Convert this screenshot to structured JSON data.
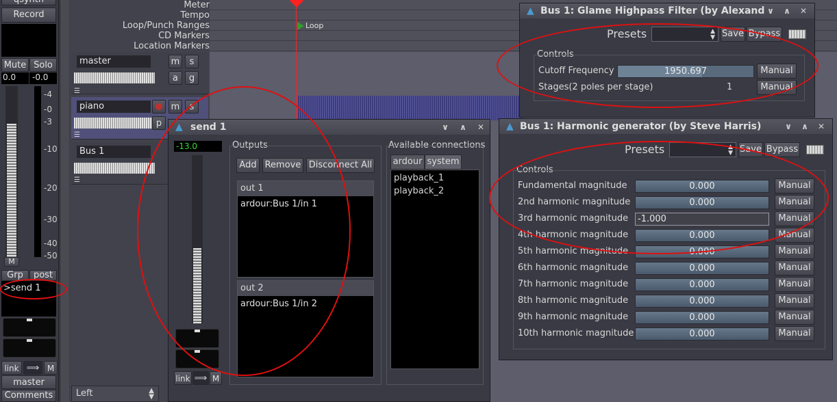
{
  "mixer": {
    "top_label": "qsynth",
    "record": "Record",
    "mute": "Mute",
    "solo": "Solo",
    "gain": "0.0",
    "peak": "-0.0",
    "scale": [
      "-4",
      "-0",
      "-3",
      "-10",
      "-20",
      "-30",
      "-40",
      "-50"
    ],
    "meter_m": "M",
    "grp": "Grp",
    "post": "post",
    "send": ">send 1",
    "link": "link",
    "m": "M",
    "name": "master",
    "comments": "Comments"
  },
  "rulers": [
    "Meter",
    "Tempo",
    "Loop/Punch Ranges",
    "CD Markers",
    "Location Markers"
  ],
  "loop_marker": "Loop",
  "tracks": [
    {
      "name": "master",
      "b1": "m",
      "b2": "s",
      "b3": "a",
      "b4": "g"
    },
    {
      "name": "piano",
      "b1": "m",
      "b2": "s",
      "b3": "p"
    },
    {
      "name": "Bus 1"
    }
  ],
  "bottom_select": "Left",
  "send_window": {
    "title": "send 1",
    "gain": "-13.0",
    "outputs_label": "Outputs",
    "add": "Add",
    "remove": "Remove",
    "disconnect_all": "Disconnect All",
    "out1": "out 1",
    "out1_conn": "ardour:Bus 1/in 1",
    "out2": "out 2",
    "out2_conn": "ardour:Bus 1/in 2",
    "available_label": "Available connections",
    "tab_ardour": "ardour",
    "tab_system": "system",
    "connections": [
      "playback_1",
      "playback_2"
    ],
    "link": "link",
    "m": "M"
  },
  "highpass_window": {
    "title": "Bus 1: Glame Highpass Filter (by Alexand",
    "presets": "Presets",
    "save": "Save",
    "bypass": "Bypass",
    "controls": "Controls",
    "cutoff_label": "Cutoff Frequency",
    "cutoff_value": "1950.697",
    "stages_label": "Stages(2 poles per stage)",
    "stages_value": "1",
    "manual": "Manual"
  },
  "harmonic_window": {
    "title": "Bus 1: Harmonic generator (by Steve Harris)",
    "presets": "Presets",
    "save": "Save",
    "bypass": "Bypass",
    "controls": "Controls",
    "manual": "Manual",
    "rows": [
      {
        "label": "Fundamental magnitude",
        "value": "0.000"
      },
      {
        "label": "2nd harmonic magnitude",
        "value": "0.000"
      },
      {
        "label": "3rd harmonic magnitude",
        "value": "-1.000"
      },
      {
        "label": "4th harmonic magnitude",
        "value": "0.000"
      },
      {
        "label": "5th harmonic magnitude",
        "value": "0.000"
      },
      {
        "label": "6th harmonic magnitude",
        "value": "0.000"
      },
      {
        "label": "7th harmonic magnitude",
        "value": "0.000"
      },
      {
        "label": "8th harmonic magnitude",
        "value": "0.000"
      },
      {
        "label": "9th harmonic magnitude",
        "value": "0.000"
      },
      {
        "label": "10th harmonic magnitude",
        "value": "0.000"
      }
    ]
  },
  "colors": {
    "accent_red": "#e01010",
    "green_text": "#33dd33",
    "playhead": "#ff2020"
  }
}
